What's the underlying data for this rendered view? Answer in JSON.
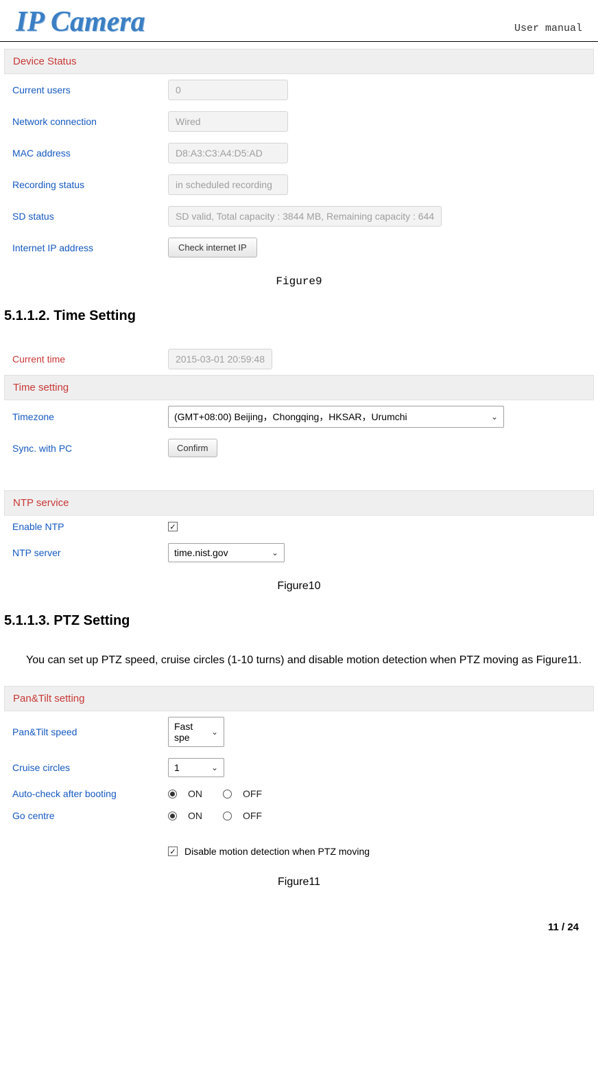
{
  "header": {
    "logo": "IP Camera",
    "right": "User manual"
  },
  "figure9": {
    "section_title": "Device Status",
    "rows": {
      "current_users": {
        "label": "Current users",
        "value": "0"
      },
      "network": {
        "label": "Network connection",
        "value": "Wired"
      },
      "mac": {
        "label": "MAC address",
        "value": "D8:A3:C3:A4:D5:AD"
      },
      "recording": {
        "label": "Recording status",
        "value": "in scheduled recording"
      },
      "sd": {
        "label": "SD status",
        "value": "SD valid, Total capacity : 3844 MB, Remaining capacity : 644"
      },
      "ip": {
        "label": "Internet IP address",
        "button": "Check internet IP"
      }
    },
    "caption": "Figure9"
  },
  "section_5112": {
    "heading": "5.1.1.2. Time Setting"
  },
  "figure10": {
    "current_time": {
      "label": "Current time",
      "value": "2015-03-01 20:59:48"
    },
    "time_setting": {
      "title": "Time setting",
      "timezone": {
        "label": "Timezone",
        "value": "(GMT+08:00) Beijing，Chongqing，HKSAR，Urumchi"
      },
      "sync": {
        "label": "Sync. with PC",
        "button": "Confirm"
      }
    },
    "ntp": {
      "title": "NTP service",
      "enable": {
        "label": "Enable NTP",
        "checked": true
      },
      "server": {
        "label": "NTP server",
        "value": "time.nist.gov"
      }
    },
    "caption": "Figure10"
  },
  "section_5113": {
    "heading": "5.1.1.3. PTZ Setting",
    "body": "You can set up PTZ speed, cruise circles (1-10 turns) and disable motion detection when PTZ moving as Figure11."
  },
  "figure11": {
    "title": "Pan&Tilt setting",
    "speed": {
      "label": "Pan&Tilt speed",
      "value": "Fast spe"
    },
    "cruise": {
      "label": "Cruise circles",
      "value": "1"
    },
    "autocheck": {
      "label": "Auto-check after booting",
      "on": "ON",
      "off": "OFF"
    },
    "gocentre": {
      "label": "Go centre",
      "on": "ON",
      "off": "OFF"
    },
    "disable_md": {
      "label": "Disable motion detection when PTZ moving",
      "checked": true
    },
    "caption": "Figure11"
  },
  "footer": {
    "page": "11 / 24"
  }
}
